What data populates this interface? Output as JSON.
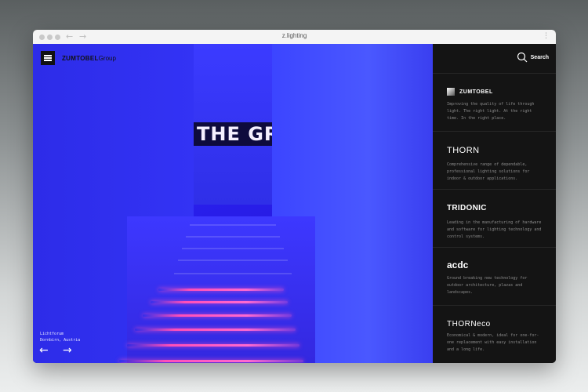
{
  "browser": {
    "url": "z.lighting",
    "back_arrow": "←",
    "forward_arrow": "→",
    "menu_glyph": "⋮"
  },
  "header": {
    "brand_main": "ZUMTOBEL",
    "brand_sub": "Group"
  },
  "hero": {
    "sign_text": "THE GRO",
    "caption_line1": "Lichtforum",
    "caption_line2": "Dornbirn, Austria",
    "prev_arrow": "←",
    "next_arrow": "→"
  },
  "search": {
    "label": "Search",
    "icon": "search-icon"
  },
  "brands": [
    {
      "name": "ZUMTOBEL",
      "description": "Improving the quality of life through light. The right light. At the right time. In the right place."
    },
    {
      "name": "THORN",
      "description": "Comprehensive range of dependable, professional lighting solutions for indoor & outdoor applications."
    },
    {
      "name": "TRIDONIC",
      "description": "Leading in the manufacturing of hardware and software for lighting technology and control systems."
    },
    {
      "name": "acdc",
      "description": "Ground breaking new technology for outdoor architecture, plazas and landscapes."
    },
    {
      "name": "THORNeco",
      "description": "Economical & modern, ideal for one-for-one replacement with easy installation and a long life."
    }
  ]
}
